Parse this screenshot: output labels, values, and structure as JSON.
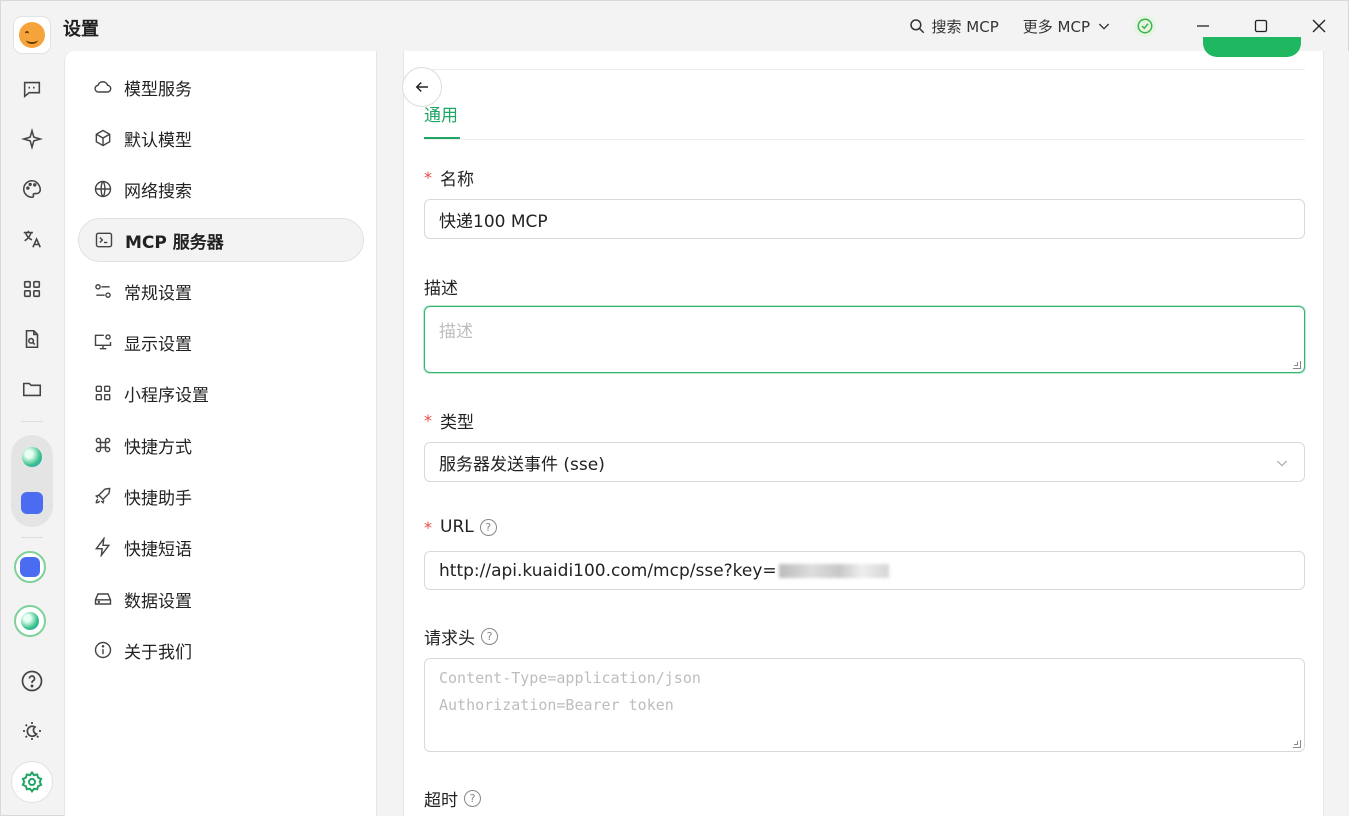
{
  "window": {
    "title": "设置"
  },
  "toolbar": {
    "search_mcp": "搜索 MCP",
    "more_mcp": "更多 MCP"
  },
  "nav": {
    "items": [
      {
        "label": "模型服务",
        "icon": "cloud-icon"
      },
      {
        "label": "默认模型",
        "icon": "cube-icon"
      },
      {
        "label": "网络搜索",
        "icon": "globe-icon"
      },
      {
        "label": "MCP 服务器",
        "icon": "terminal-icon",
        "active": true
      },
      {
        "label": "常规设置",
        "icon": "sliders-icon"
      },
      {
        "label": "显示设置",
        "icon": "monitor-gear-icon"
      },
      {
        "label": "小程序设置",
        "icon": "grid-icon"
      },
      {
        "label": "快捷方式",
        "icon": "command-icon"
      },
      {
        "label": "快捷助手",
        "icon": "rocket-icon"
      },
      {
        "label": "快捷短语",
        "icon": "bolt-icon"
      },
      {
        "label": "数据设置",
        "icon": "drive-icon"
      },
      {
        "label": "关于我们",
        "icon": "info-icon"
      }
    ]
  },
  "form": {
    "tab_general": "通用",
    "name_label": "名称",
    "name_value": "快递100 MCP",
    "desc_label": "描述",
    "desc_placeholder": "描述",
    "type_label": "类型",
    "type_value": "服务器发送事件 (sse)",
    "url_label": "URL",
    "url_value": "http://api.kuaidi100.com/mcp/sse?key=",
    "headers_label": "请求头",
    "headers_placeholder_1": "Content-Type=application/json",
    "headers_placeholder_2": "Authorization=Bearer token",
    "timeout_label": "超时",
    "required_mark": "*",
    "help_mark": "?"
  },
  "colors": {
    "accent": "#1fa564",
    "required": "#e84a4a",
    "focus_border": "#2eb872"
  }
}
